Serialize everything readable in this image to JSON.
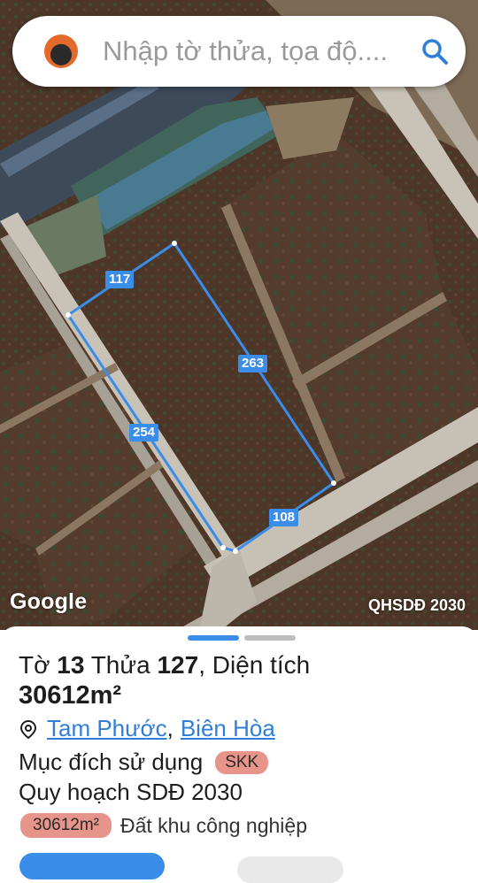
{
  "search": {
    "placeholder": "Nhập tờ thửa, tọa độ...."
  },
  "map": {
    "edge_labels": [
      "117",
      "263",
      "254",
      "108"
    ],
    "attribution": "Google",
    "layer": "QHSDĐ 2030",
    "parcel_color": "#3a8de8"
  },
  "parcel": {
    "sheet_label": "Tờ",
    "sheet_no": "13",
    "parcel_label": "Thửa",
    "parcel_no": "127",
    "area_label": "Diện tích",
    "area": "30612m²",
    "ward": "Tam Phước",
    "city": "Biên Hòa",
    "purpose_label": "Mục đích sử dụng",
    "purpose_code": "SKK",
    "plan_label": "Quy hoạch SDĐ 2030",
    "plan_area": "30612m²",
    "plan_desc": "Đất khu công nghiệp",
    "badge_color": "#e7958a"
  }
}
